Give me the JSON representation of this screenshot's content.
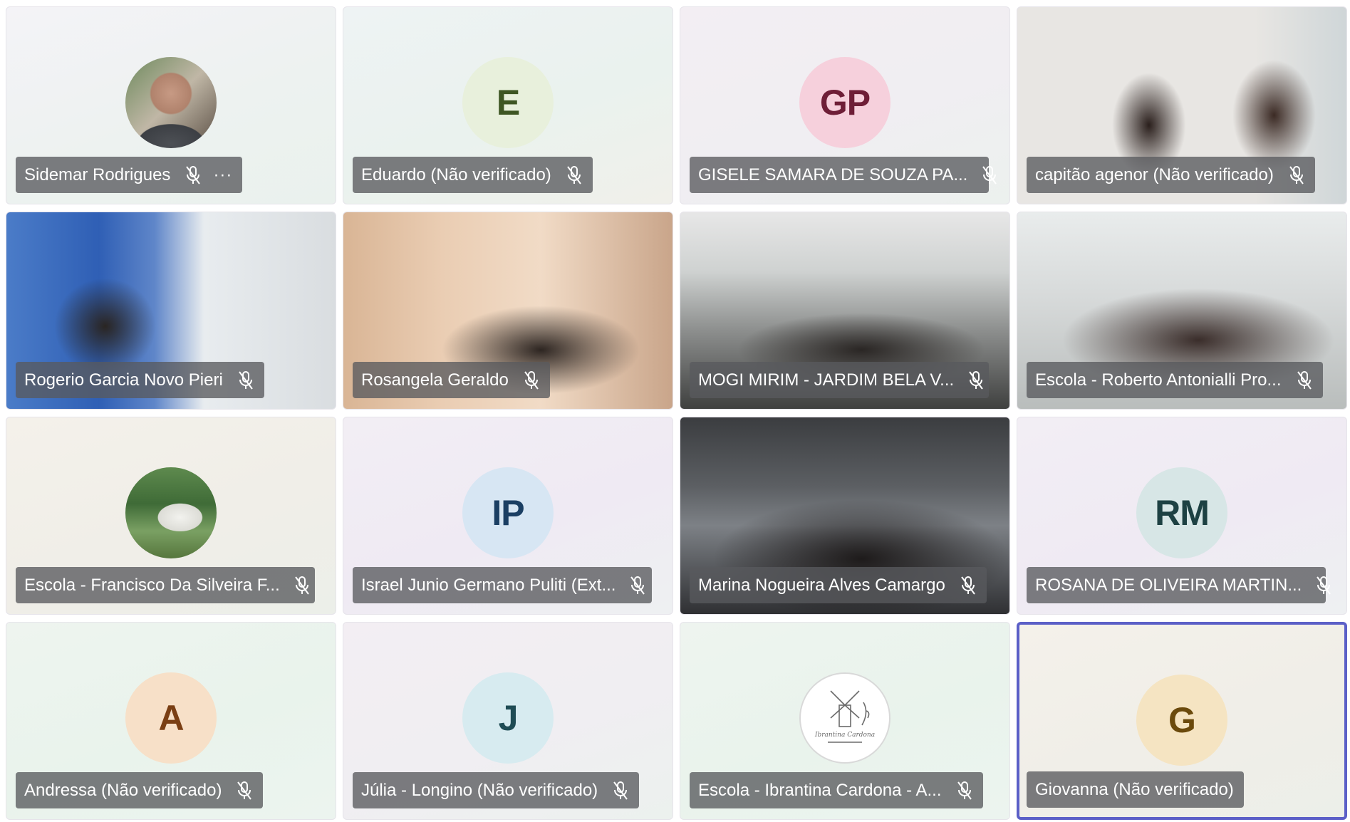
{
  "participants": [
    {
      "name": "Sidemar Rodrigues",
      "avatar": {
        "type": "photo",
        "icon": "person-photo"
      },
      "muted": true,
      "more": "···"
    },
    {
      "name": "Eduardo (Não verificado)",
      "avatar": {
        "type": "initials",
        "initials": "E"
      },
      "muted": true
    },
    {
      "name": "GISELE SAMARA DE SOUZA PA...",
      "avatar": {
        "type": "initials",
        "initials": "GP"
      },
      "muted": true
    },
    {
      "name": "capitão agenor (Não verificado)",
      "avatar": {
        "type": "video"
      },
      "muted": true
    },
    {
      "name": "Rogerio Garcia Novo Pieri",
      "avatar": {
        "type": "video"
      },
      "muted": true
    },
    {
      "name": "Rosangela Geraldo",
      "avatar": {
        "type": "video"
      },
      "muted": true
    },
    {
      "name": "MOGI MIRIM - JARDIM BELA V...",
      "avatar": {
        "type": "video"
      },
      "muted": true
    },
    {
      "name": "Escola - Roberto Antonialli Pro...",
      "avatar": {
        "type": "video"
      },
      "muted": true
    },
    {
      "name": "Escola - Francisco Da Silveira F...",
      "avatar": {
        "type": "photo",
        "icon": "building-photo"
      },
      "muted": true
    },
    {
      "name": "Israel Junio Germano Puliti (Ext...",
      "avatar": {
        "type": "initials",
        "initials": "IP"
      },
      "muted": true
    },
    {
      "name": "Marina Nogueira Alves Camargo",
      "avatar": {
        "type": "video"
      },
      "muted": true
    },
    {
      "name": "ROSANA DE OLIVEIRA MARTIN...",
      "avatar": {
        "type": "initials",
        "initials": "RM"
      },
      "muted": true
    },
    {
      "name": "Andressa (Não verificado)",
      "avatar": {
        "type": "initials",
        "initials": "A"
      },
      "muted": true
    },
    {
      "name": "Júlia - Longino (Não verificado)",
      "avatar": {
        "type": "initials",
        "initials": "J"
      },
      "muted": true
    },
    {
      "name": "Escola - Ibrantina Cardona - A...",
      "avatar": {
        "type": "photo",
        "icon": "windmill-logo"
      },
      "muted": true
    },
    {
      "name": "Giovanna (Não verificado)",
      "avatar": {
        "type": "initials",
        "initials": "G"
      },
      "muted": false,
      "active_speaker": true
    }
  ],
  "colors": {
    "name_tag_bg": "#585a5e",
    "active_speaker_border": "#5b5fc7"
  }
}
